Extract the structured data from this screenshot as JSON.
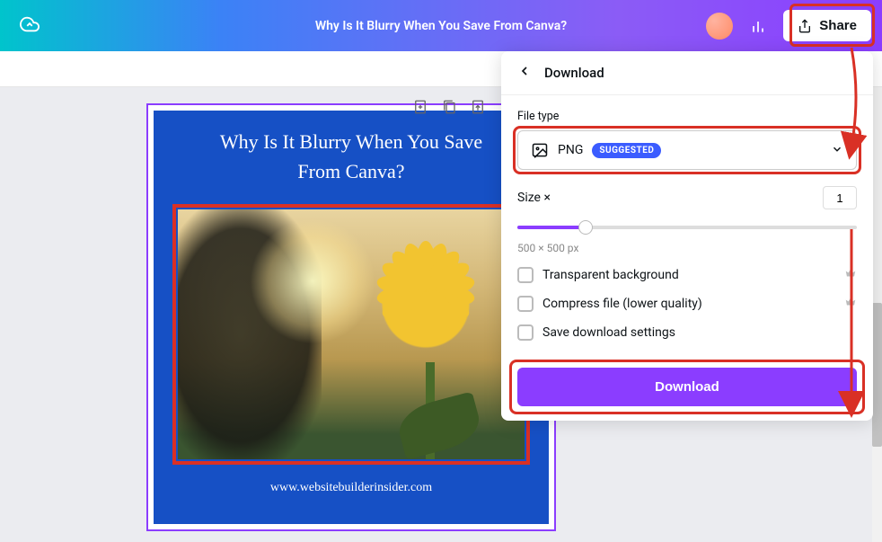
{
  "header": {
    "title": "Why Is It Blurry When You Save From Canva?",
    "share_label": "Share"
  },
  "canvas": {
    "title_line1": "Why Is It Blurry When You Save",
    "title_line2": "From Canva?",
    "footer": "www.websitebuilderinsider.com"
  },
  "panel": {
    "title": "Download",
    "file_type_label": "File type",
    "file_type_value": "PNG",
    "suggested_badge": "SUGGESTED",
    "size_label": "Size ×",
    "size_value": "1",
    "dimensions": "500 × 500 px",
    "options": {
      "transparent": "Transparent background",
      "compress": "Compress file (lower quality)",
      "save_settings": "Save download settings"
    },
    "download_button": "Download"
  }
}
